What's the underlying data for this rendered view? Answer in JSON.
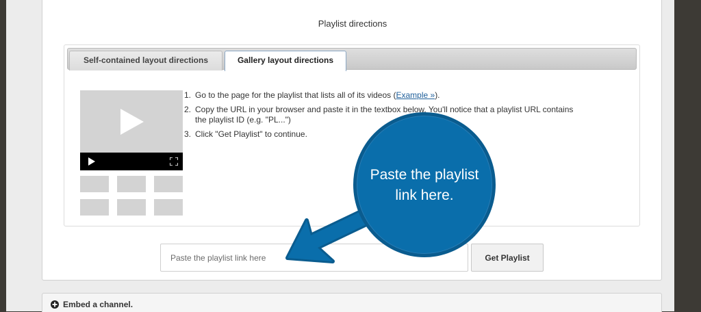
{
  "section": {
    "title": "Playlist directions"
  },
  "tabs": [
    {
      "label": "Self-contained layout directions",
      "selected": false
    },
    {
      "label": "Gallery layout directions",
      "selected": true
    }
  ],
  "steps": {
    "s1_num": "1.",
    "s1_text": "Go to the page for the playlist that lists all of its videos (",
    "s1_link": "Example »",
    "s1_end": ").",
    "s2_num": "2.",
    "s2_line1": "Copy the URL in your browser and paste it in the textbox below. You'll notice that a playlist URL contains",
    "s2_line2": "the playlist ID (e.g. \"PL...\")",
    "s3_num": "3.",
    "s3_text": "Click \"Get Playlist\" to continue."
  },
  "input": {
    "placeholder": "Paste the playlist link here",
    "value": ""
  },
  "button": {
    "label": "Get Playlist"
  },
  "embed": {
    "label": "Embed a channel."
  },
  "callout": {
    "line1": "Paste the playlist",
    "line2": "link here."
  },
  "colors": {
    "callout": "#0a6eab",
    "frame": "#3d3a35",
    "link": "#1f5f9a"
  },
  "icons": {
    "thumbnail_play": "play-triangle-icon",
    "player_play": "play-icon",
    "fullscreen": "fullscreen-icon",
    "embed": "plus-circle-icon"
  }
}
